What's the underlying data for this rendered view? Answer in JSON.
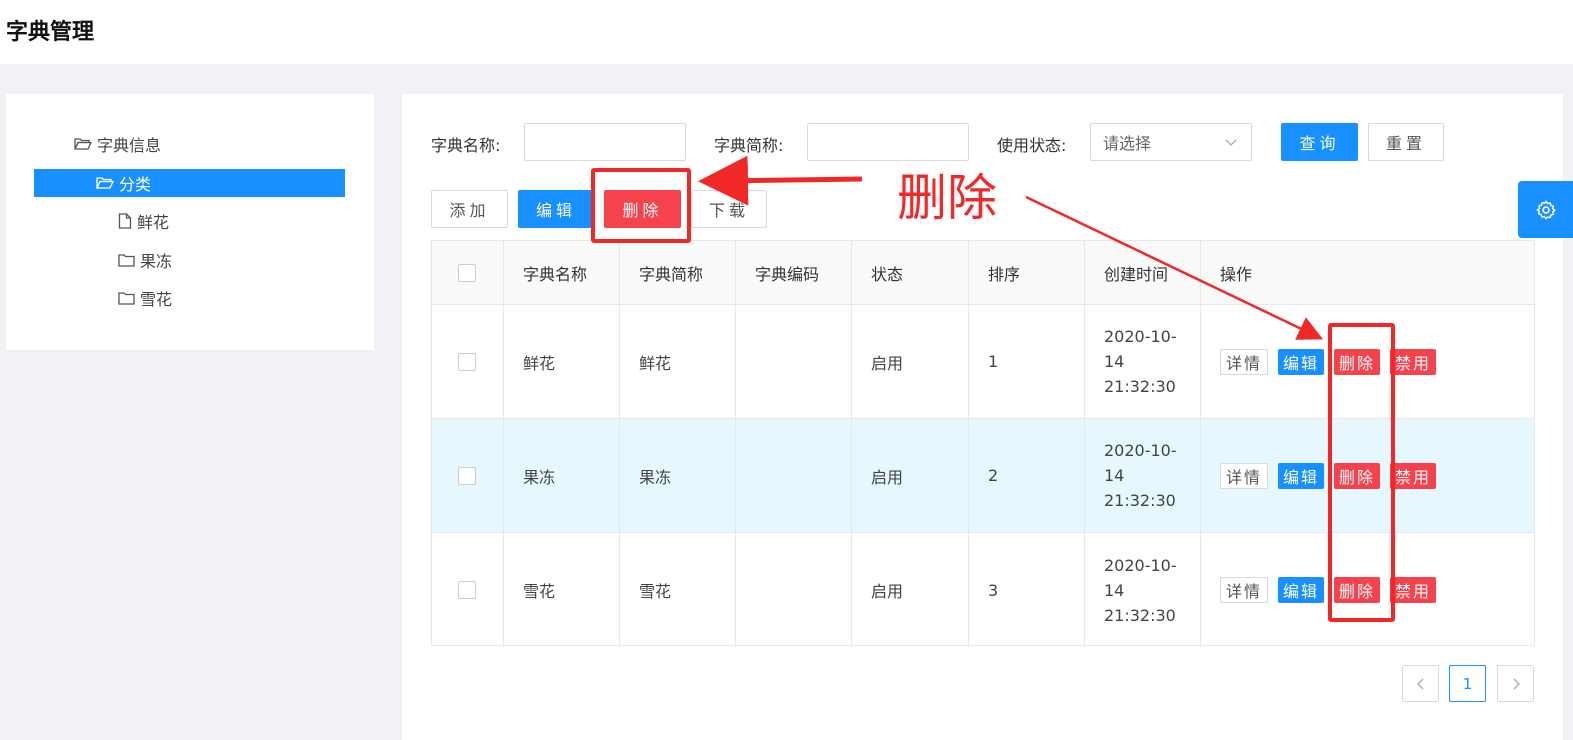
{
  "page_title": "字典管理",
  "tree": {
    "root": "字典信息",
    "category": "分类",
    "items": [
      "鲜花",
      "果冻",
      "雪花"
    ]
  },
  "filters": {
    "name_label": "字典名称:",
    "abbr_label": "字典简称:",
    "status_label": "使用状态:",
    "status_placeholder": "请选择",
    "name_value": "",
    "abbr_value": "",
    "query": "查询",
    "reset": "重置"
  },
  "toolbar": {
    "add": "添加",
    "edit": "编辑",
    "delete": "删除",
    "download": "下载"
  },
  "table": {
    "headers": [
      "字典名称",
      "字典简称",
      "字典编码",
      "状态",
      "排序",
      "创建时间",
      "操作"
    ],
    "rows": [
      {
        "name": "鲜花",
        "abbr": "鲜花",
        "code": "",
        "status": "启用",
        "order": "1",
        "time": [
          "2020-10-",
          "14",
          "21:32:30"
        ]
      },
      {
        "name": "果冻",
        "abbr": "果冻",
        "code": "",
        "status": "启用",
        "order": "2",
        "time": [
          "2020-10-",
          "14",
          "21:32:30"
        ]
      },
      {
        "name": "雪花",
        "abbr": "雪花",
        "code": "",
        "status": "启用",
        "order": "3",
        "time": [
          "2020-10-",
          "14",
          "21:32:30"
        ]
      }
    ],
    "ops": {
      "detail": "详情",
      "edit": "编辑",
      "delete": "删除",
      "disable": "禁用"
    }
  },
  "pagination": {
    "prev": "<",
    "page": "1",
    "next": ">"
  },
  "annotation": {
    "text": "删除",
    "color": "#f02828"
  },
  "colors": {
    "primary": "#1890ff",
    "danger": "#f5424d",
    "highlight_row": "#e6f7fd"
  }
}
